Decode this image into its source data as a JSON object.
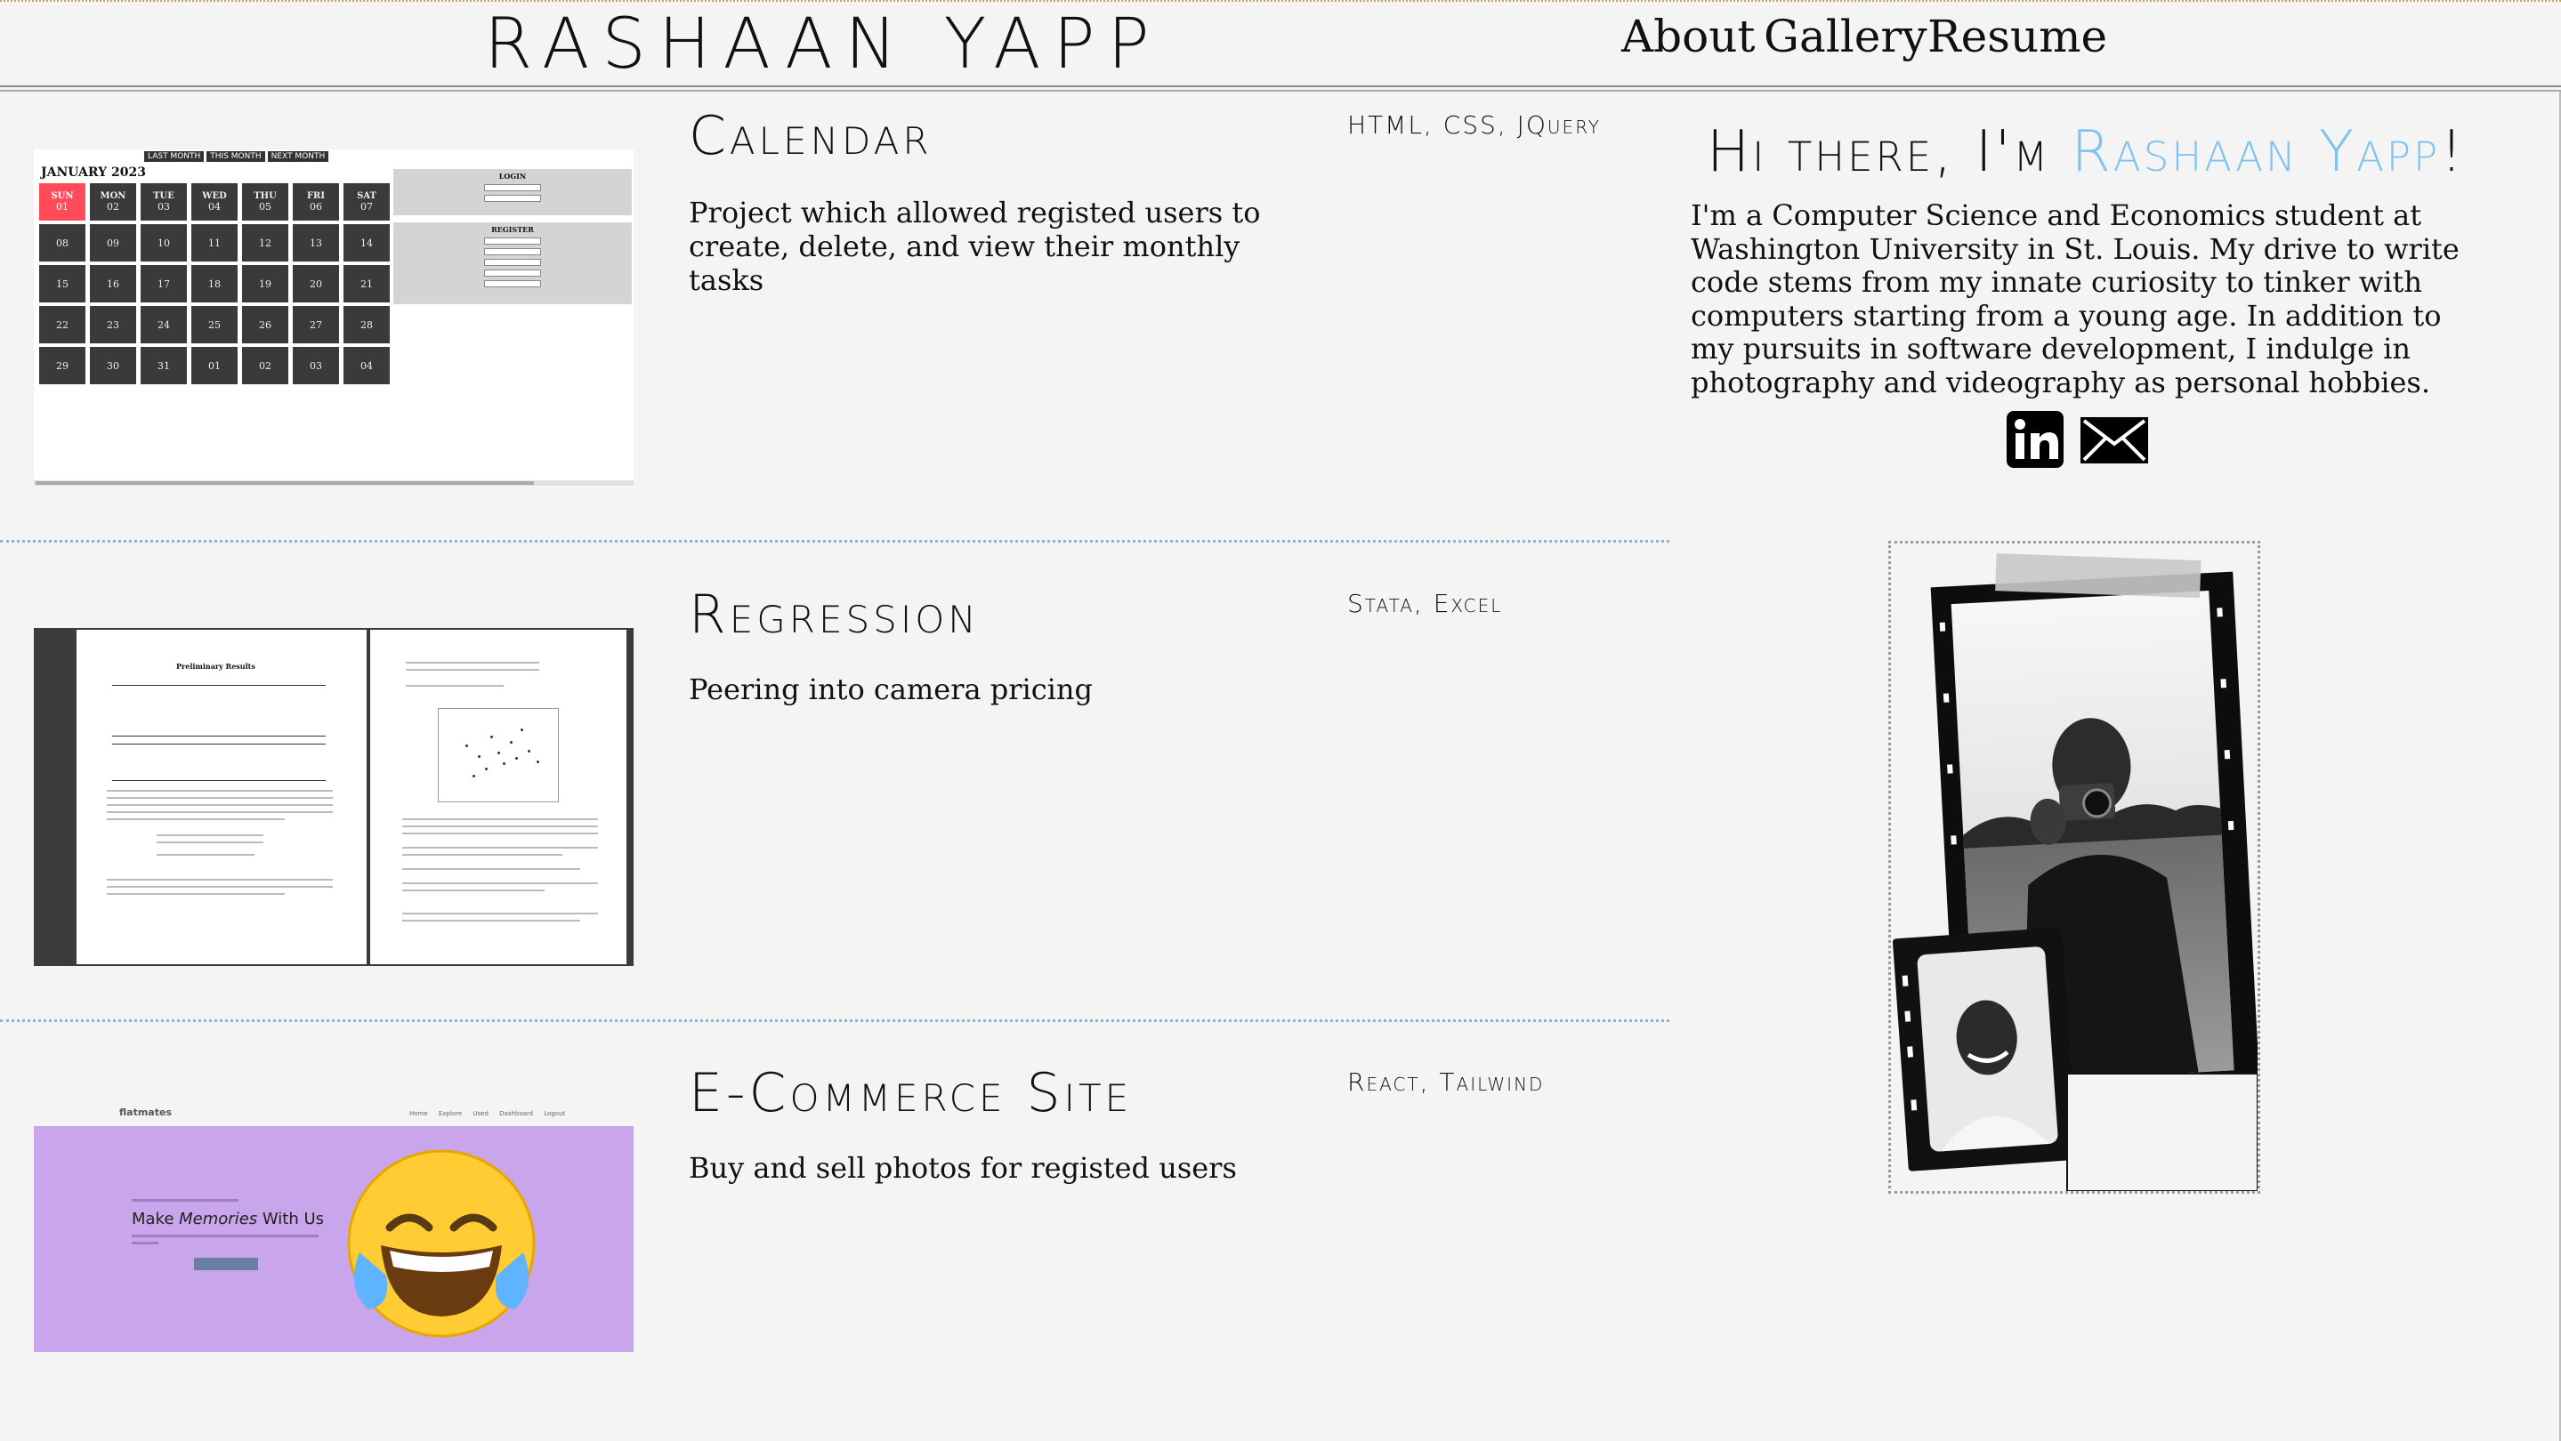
{
  "header": {
    "logo": "RASHAAN YAPP",
    "nav": [
      {
        "label": "About"
      },
      {
        "label": "Gallery"
      },
      {
        "label": "Resume"
      }
    ]
  },
  "projects": [
    {
      "title": "Calendar",
      "tech": "HTML, CSS, JQuery",
      "description": "Project which allowed registed users to create, delete, and view their monthly tasks",
      "thumb": {
        "buttons": [
          "LAST MONTH",
          "THIS MONTH",
          "NEXT MONTH"
        ],
        "month": "JANUARY 2023",
        "days": [
          "SUN",
          "MON",
          "TUE",
          "WED",
          "THU",
          "FRI",
          "SAT"
        ],
        "dates": [
          "01",
          "02",
          "03",
          "04",
          "05",
          "06",
          "07",
          "08",
          "09",
          "10",
          "11",
          "12",
          "13",
          "14",
          "15",
          "16",
          "17",
          "18",
          "19",
          "20",
          "21",
          "22",
          "23",
          "24",
          "25",
          "26",
          "27",
          "28",
          "29",
          "30",
          "31",
          "01",
          "02",
          "03",
          "04"
        ],
        "login_label": "LOGIN",
        "register_label": "REGISTER"
      }
    },
    {
      "title": "Regression",
      "tech": "Stata, Excel",
      "description": "Peering into camera pricing",
      "thumb": {
        "page_title": "Preliminary Results"
      }
    },
    {
      "title": "E-Commerce Site",
      "tech": "React, Tailwind",
      "description": "Buy and sell photos for registed users",
      "thumb": {
        "brand": "flatmates",
        "links": "Home Explore Used Dashboard Logout",
        "tagline_pre": "Make ",
        "tagline_em": "Memories",
        "tagline_post": " With Us",
        "emoji": "face-with-tears-of-joy"
      }
    }
  ],
  "hero": {
    "greeting": "Hi there, I'm ",
    "name": "Rashaan Yapp",
    "exclaim": "!",
    "bio": "I'm a Computer Science and Economics student at Washington University in St. Louis. My drive to write code stems from my innate curiosity to tinker with computers starting from a young age. In addition to my pursuits in software development, I indulge in photography and videography as personal hobbies.",
    "accent_color": "#7ec3ef",
    "social": [
      {
        "icon": "linkedin-icon"
      },
      {
        "icon": "mail-icon"
      }
    ]
  },
  "colors": {
    "background": "#f4f4f4",
    "divider": "#7fb7dc",
    "calendar_today": "#ff4b5a",
    "ecommerce_band": "#c9a5ec"
  }
}
